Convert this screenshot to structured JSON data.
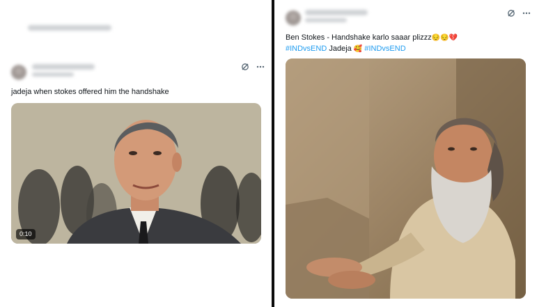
{
  "left_tweet": {
    "text": "jadeja when stokes offered him the handshake",
    "video_duration": "0:10",
    "icons": [
      "grok-icon",
      "more-icon"
    ]
  },
  "right_tweet": {
    "text_line1": "Ben Stokes - Handshake karlo saaar plizzz",
    "text_line1_emojis": "😔😔💔",
    "hashtag1": "#INDvsEND",
    "mention": "Jadeja",
    "mention_emoji": "🥰",
    "hashtag2": "#INDvsEND",
    "icons": [
      "grok-icon",
      "more-icon"
    ]
  },
  "colors": {
    "hashtag": "#1d9bf0",
    "text": "#0f1419",
    "icon": "#536471",
    "divider": "#0b0b0b"
  }
}
